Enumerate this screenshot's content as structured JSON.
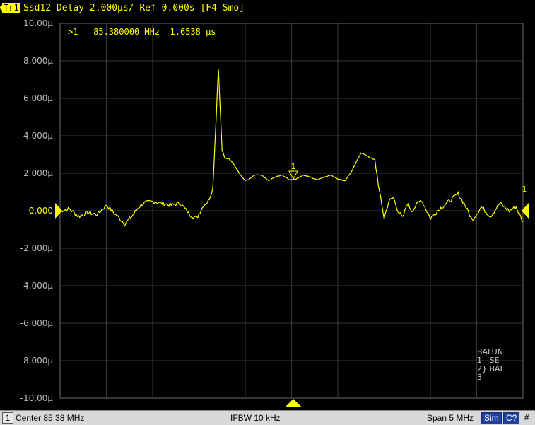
{
  "header": {
    "trace_label": "Tr1",
    "trace_description": "Ssd12 Delay 2.000µs/ Ref 0.000s [F4 Smo]"
  },
  "y_axis": {
    "labels": [
      "10.00µ",
      "8.000µ",
      "6.000µ",
      "4.000µ",
      "2.000µ",
      "0.000",
      "-2.000µ",
      "-4.000µ",
      "-6.000µ",
      "-8.000µ",
      "-10.00µ"
    ],
    "reference_value": "0.000"
  },
  "marker": {
    "label": "1",
    "readout": ">1   85.380000 MHz  1.6538 µs",
    "right_edge_label": "1"
  },
  "balun": {
    "title": "BALUN",
    "line1": "1   SE",
    "line2a": "2",
    "line2b": "} BAL",
    "line3": "3"
  },
  "status_bar": {
    "channel": "1",
    "center": "Center 85.38 MHz",
    "ifbw": "IFBW 10 kHz",
    "span": "Span 5 MHz",
    "sim": "Sim",
    "cal": "C?",
    "hash": "#"
  },
  "colors": {
    "trace": "#ffff00",
    "grid": "#3a3a3a",
    "background": "#000000"
  },
  "chart_data": {
    "type": "line",
    "y_min": -10,
    "y_max": 10,
    "y_unit": "µs",
    "x_divisions": 10,
    "y_divisions": 10,
    "series": [
      {
        "values_x_div": [
          0,
          0.2,
          0.4,
          0.6,
          0.8,
          1.0,
          1.2,
          1.4,
          1.55,
          1.7,
          1.8,
          2.0,
          2.2,
          2.4,
          2.6,
          2.8,
          2.95,
          3.1,
          3.2,
          3.3,
          3.42,
          3.5,
          3.58,
          3.66,
          3.72,
          3.8,
          3.9,
          4.0,
          4.1,
          4.2,
          4.35,
          4.5,
          4.65,
          4.8,
          4.95,
          5.1,
          5.25,
          5.4,
          5.55,
          5.7,
          5.85,
          6.0,
          6.15,
          6.3,
          6.5,
          6.65,
          6.8,
          6.9,
          7.0,
          7.1,
          7.2,
          7.3,
          7.4,
          7.5,
          7.6,
          7.8,
          8.0,
          8.2,
          8.4,
          8.6,
          8.75,
          8.9,
          9.1,
          9.3,
          9.5,
          9.7,
          9.85,
          10.0
        ],
        "values_us": [
          0.0,
          0.1,
          -0.3,
          -0.1,
          -0.2,
          0.3,
          -0.2,
          -0.7,
          -0.3,
          0.2,
          0.4,
          0.5,
          0.4,
          0.3,
          0.4,
          -0.2,
          -0.4,
          0.3,
          0.5,
          1.2,
          7.6,
          3.2,
          2.7,
          2.8,
          2.6,
          2.3,
          1.9,
          1.6,
          1.7,
          1.9,
          1.9,
          1.6,
          1.8,
          1.9,
          1.65,
          1.7,
          1.9,
          1.8,
          1.65,
          1.8,
          1.9,
          1.7,
          1.6,
          2.1,
          3.1,
          2.9,
          2.7,
          1.0,
          -0.4,
          0.5,
          0.7,
          0.0,
          -0.4,
          0.4,
          0.0,
          0.6,
          -0.4,
          0.1,
          0.5,
          0.9,
          0.3,
          -0.5,
          0.2,
          -0.3,
          0.4,
          0.0,
          0.2,
          -0.6
        ]
      }
    ]
  }
}
